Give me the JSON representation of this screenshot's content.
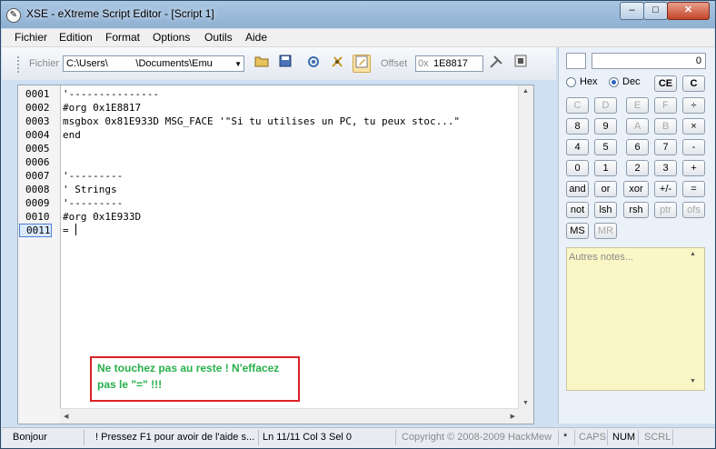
{
  "window": {
    "title": "XSE - eXtreme Script Editor - [Script 1]",
    "app_icon": "script-app-icon"
  },
  "window_buttons": {
    "minimize": "–",
    "maximize": "□",
    "close": "✕"
  },
  "menu": [
    "Fichier",
    "Edition",
    "Format",
    "Options",
    "Outils",
    "Aide"
  ],
  "toolbar": {
    "file_label": "Fichier",
    "file_path": "C:\\Users\\          \\Documents\\Emu",
    "offset_label": "Offset",
    "offset_prefix": "0x",
    "offset_value": "1E8817",
    "icons": [
      "open-folder-icon",
      "save-icon",
      "compile-icon",
      "debug-icon",
      "edit-script-icon",
      "tools-icon",
      "insert-icon"
    ]
  },
  "editor": {
    "lines": [
      {
        "no": "0001",
        "text": "'---------------"
      },
      {
        "no": "0002",
        "text": "#org 0x1E8817"
      },
      {
        "no": "0003",
        "text": "msgbox 0x81E933D MSG_FACE '\"Si tu utilises un PC, tu peux stoc...\""
      },
      {
        "no": "0004",
        "text": "end"
      },
      {
        "no": "0005",
        "text": ""
      },
      {
        "no": "0006",
        "text": ""
      },
      {
        "no": "0007",
        "text": "'---------"
      },
      {
        "no": "0008",
        "text": "' Strings"
      },
      {
        "no": "0009",
        "text": "'---------"
      },
      {
        "no": "0010",
        "text": "#org 0x1E933D"
      },
      {
        "no": "0011",
        "text": "= "
      }
    ],
    "current_line": "0011"
  },
  "annotation": {
    "line1": "Ne touchez pas au reste ! N'effacez",
    "line2": "pas le \"=\" !!!"
  },
  "calculator": {
    "display": "0",
    "hex_label": "Hex",
    "dec_label": "Dec",
    "mode": "Dec",
    "keys": [
      [
        {
          "label": "CE",
          "enabled": true
        },
        {
          "label": "C",
          "enabled": true
        }
      ],
      [
        {
          "label": "C",
          "enabled": false
        },
        {
          "label": "D",
          "enabled": false
        },
        {
          "label": "E",
          "enabled": false
        },
        {
          "label": "F",
          "enabled": false
        },
        {
          "label": "÷",
          "enabled": true
        }
      ],
      [
        {
          "label": "8",
          "enabled": true
        },
        {
          "label": "9",
          "enabled": true
        },
        {
          "label": "A",
          "enabled": false
        },
        {
          "label": "B",
          "enabled": false
        },
        {
          "label": "×",
          "enabled": true
        }
      ],
      [
        {
          "label": "4",
          "enabled": true
        },
        {
          "label": "5",
          "enabled": true
        },
        {
          "label": "6",
          "enabled": true
        },
        {
          "label": "7",
          "enabled": true
        },
        {
          "label": "-",
          "enabled": true
        }
      ],
      [
        {
          "label": "0",
          "enabled": true
        },
        {
          "label": "1",
          "enabled": true
        },
        {
          "label": "2",
          "enabled": true
        },
        {
          "label": "3",
          "enabled": true
        },
        {
          "label": "+",
          "enabled": true
        }
      ],
      [
        {
          "label": "and",
          "enabled": true
        },
        {
          "label": "or",
          "enabled": true
        },
        {
          "label": "xor",
          "enabled": true
        },
        {
          "label": "+/-",
          "enabled": true
        },
        {
          "label": "=",
          "enabled": true
        }
      ],
      [
        {
          "label": "not",
          "enabled": true
        },
        {
          "label": "lsh",
          "enabled": true
        },
        {
          "label": "rsh",
          "enabled": true
        },
        {
          "label": "ptr",
          "enabled": false
        },
        {
          "label": "ofs",
          "enabled": false
        }
      ],
      [
        {
          "label": "MS",
          "enabled": true
        },
        {
          "label": "MR",
          "enabled": false
        }
      ]
    ],
    "notes_placeholder": "Autres notes..."
  },
  "status": {
    "message": "Bonjour",
    "hint": "! Pressez F1 pour avoir de l'aide s...",
    "position": "Ln 11/11  Col 3  Sel 0",
    "copyright": "Copyright © 2008-2009 HackMew",
    "modified": "*",
    "caps": "CAPS",
    "num": "NUM",
    "scrl": "SCRL"
  },
  "colors": {
    "annotation_border": "#d91f26",
    "annotation_text": "#27b04a",
    "notes_bg": "#fbf6c6"
  }
}
